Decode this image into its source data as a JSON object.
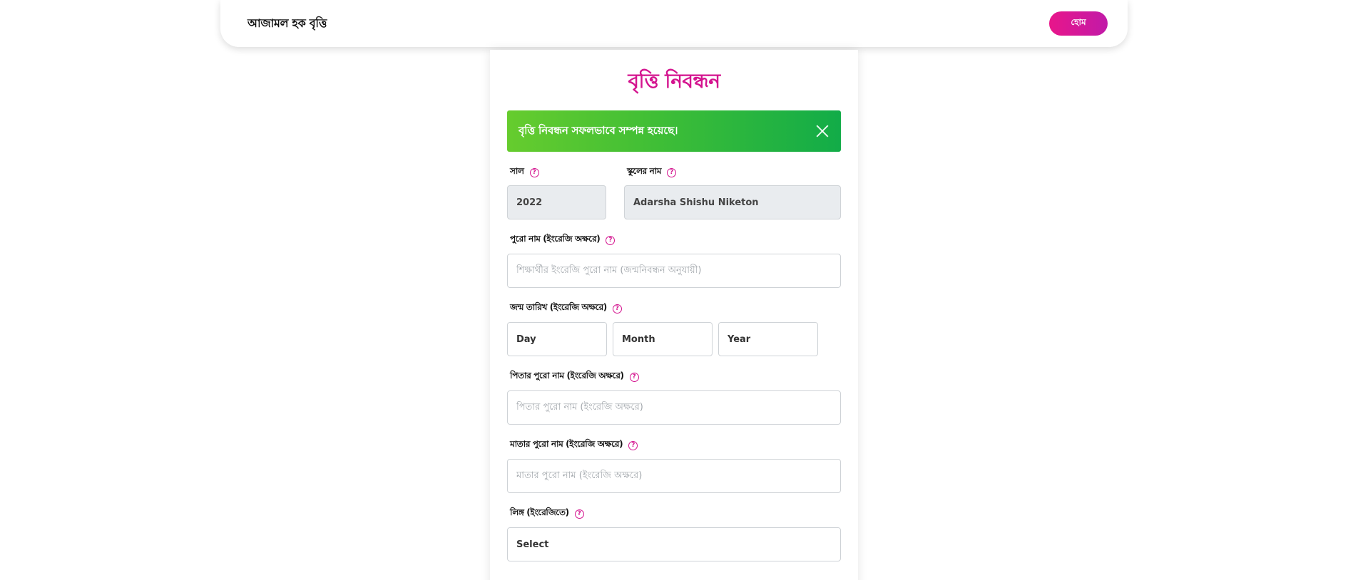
{
  "nav": {
    "brand": "আজামল হক বৃত্তি",
    "home_label": "হোম"
  },
  "form": {
    "title": "বৃত্তি নিবন্ধন",
    "alert": "বৃত্তি নিবন্ধন সফলভাবে সম্পন্ন হয়েছে।",
    "help_glyph": "?",
    "year": {
      "label": "সাল",
      "value": "2022"
    },
    "school": {
      "label": "স্কুলের নাম",
      "value": "Adarsha Shishu Niketon"
    },
    "full_name": {
      "label": "পুরো নাম (ইংরেজি অক্ষরে)",
      "placeholder": "শিক্ষার্থীর ইংরেজি পুরো নাম (জন্মনিবন্ধন অনুযায়ী)"
    },
    "dob": {
      "label": "জন্ম তারিখ (ইংরেজি অক্ষরে)",
      "day": "Day",
      "month": "Month",
      "year": "Year"
    },
    "father_name": {
      "label": "পিতার পুরো নাম (ইংরেজি অক্ষরে)",
      "placeholder": "পিতার পুরো নাম (ইংরেজি অক্ষরে)"
    },
    "mother_name": {
      "label": "মাতার পুরো নাম (ইংরেজি অক্ষরে)",
      "placeholder": "মাতার পুরো নাম (ইংরেজি অক্ষরে)"
    },
    "gender": {
      "label": "লিঙ্গ (ইংরেজিতে)",
      "value": "Select"
    }
  },
  "colors": {
    "accent": "#d4148f",
    "button_gradient_start": "#e8168a",
    "button_gradient_end": "#c11aa8",
    "alert_gradient_start": "#66cc2e",
    "alert_gradient_end": "#12ac48",
    "disabled_bg": "#e9ecef"
  }
}
